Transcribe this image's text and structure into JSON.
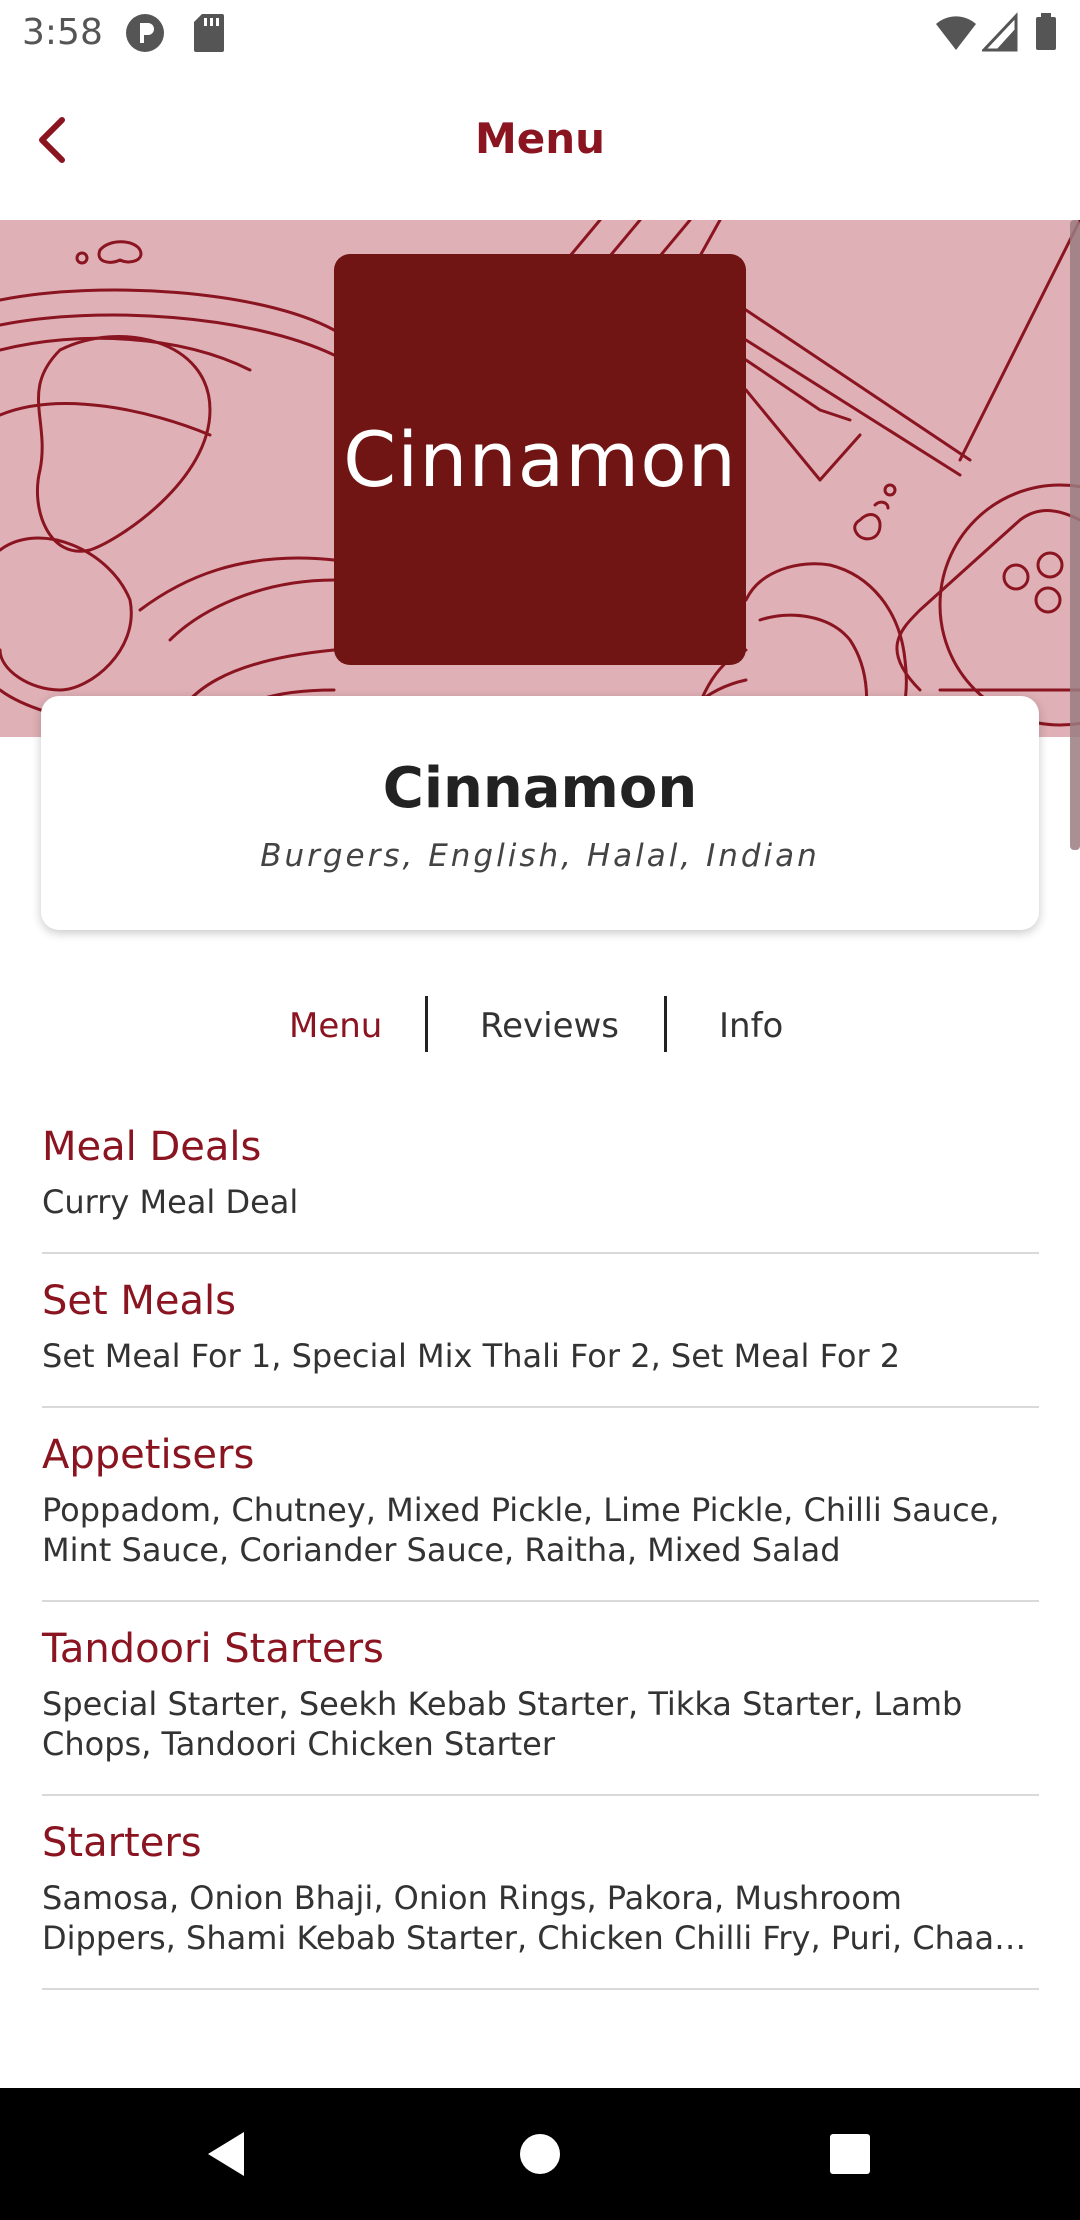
{
  "status_bar": {
    "time": "3:58",
    "icons": [
      "p-notification-icon",
      "sd-card-icon",
      "wifi-icon",
      "signal-icon",
      "battery-icon"
    ]
  },
  "app_bar": {
    "title": "Menu",
    "back_icon": "chevron-left-icon"
  },
  "banner": {
    "logo_text": "Cinnamon",
    "background_color": "#dfb0b6",
    "logo_color": "#711514"
  },
  "restaurant": {
    "name": "Cinnamon",
    "cuisines": "Burgers, English, Halal, Indian"
  },
  "tabs": [
    {
      "label": "Menu",
      "active": true
    },
    {
      "label": "Reviews",
      "active": false
    },
    {
      "label": "Info",
      "active": false
    }
  ],
  "menu_sections": [
    {
      "title": "Meal Deals",
      "items": "Curry Meal Deal"
    },
    {
      "title": "Set Meals",
      "items": "Set Meal For 1, Special Mix Thali For 2, Set Meal For 2"
    },
    {
      "title": "Appetisers",
      "items_line1": "Poppadom, Chutney, Mixed Pickle, Lime Pickle, Chilli Sauce,",
      "items_line2": "Mint Sauce, Coriander Sauce, Raitha, Mixed Salad"
    },
    {
      "title": "Tandoori Starters",
      "items_line1": "Special Starter, Seekh Kebab Starter, Tikka Starter, Lamb",
      "items_line2": "Chops, Tandoori Chicken Starter"
    },
    {
      "title": "Starters",
      "items_line1": "Samosa, Onion Bhaji, Onion Rings, Pakora, Mushroom",
      "items_line2": "Dippers, Shami Kebab Starter, Chicken Chilli Fry, Puri, Chaa…"
    }
  ],
  "nav_bar": {
    "icons": [
      "nav-back-icon",
      "nav-home-icon",
      "nav-recents-icon"
    ]
  },
  "colors": {
    "accent": "#8a1420",
    "text_dark": "#222222",
    "divider": "#d9d9d9"
  }
}
